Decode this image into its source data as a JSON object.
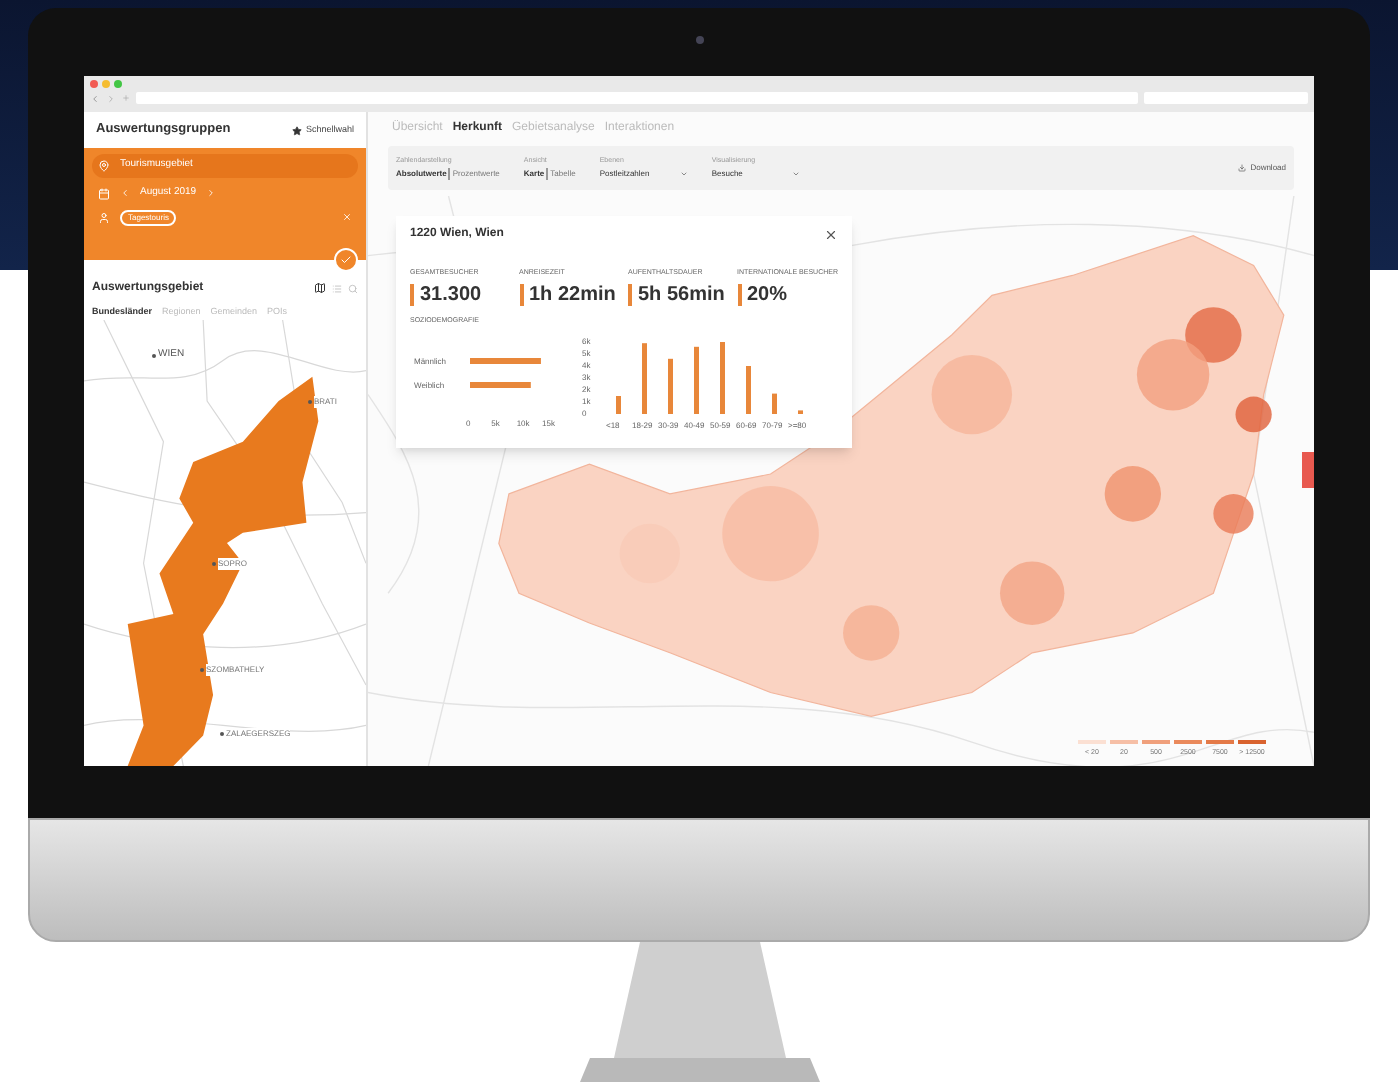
{
  "sidebar": {
    "title": "Auswertungsgruppen",
    "quick_pick": "Schnellwahl",
    "group": {
      "area": "Tourismusgebiet",
      "month": "August 2019",
      "tag": "Tagestouris"
    },
    "area_title": "Auswertungsgebiet",
    "area_tabs": [
      {
        "label": "Bundesländer",
        "selected": true
      },
      {
        "label": "Regionen",
        "selected": false
      },
      {
        "label": "Gemeinden",
        "selected": false
      },
      {
        "label": "POIs",
        "selected": false
      }
    ],
    "map_labels": [
      "WIEN",
      "BRATI",
      "SOPRO",
      "SZOMBATHELY",
      "ZALAEGERSZEG"
    ]
  },
  "tabs": [
    {
      "label": "Übersicht",
      "selected": false
    },
    {
      "label": "Herkunft",
      "selected": true
    },
    {
      "label": "Gebietsanalyse",
      "selected": false
    },
    {
      "label": "Interaktionen",
      "selected": false
    }
  ],
  "filters": [
    {
      "kind": "toggle",
      "label": "Zahlendarstellung",
      "options": [
        {
          "label": "Absolutwerte",
          "selected": true
        },
        {
          "label": "Prozentwerte",
          "selected": false
        }
      ]
    },
    {
      "kind": "toggle",
      "label": "Ansicht",
      "options": [
        {
          "label": "Karte",
          "selected": true
        },
        {
          "label": "Tabelle",
          "selected": false
        }
      ]
    },
    {
      "kind": "select",
      "label": "Ebenen",
      "value": "Postleitzahlen"
    },
    {
      "kind": "select",
      "label": "Visualisierung",
      "value": "Besuche"
    }
  ],
  "download": "Download",
  "popup": {
    "title": "1220 Wien, Wien",
    "stats": [
      {
        "label": "GESAMTBESUCHER",
        "value": "31.300"
      },
      {
        "label": "ANREISEZEIT",
        "value": "1h 22min"
      },
      {
        "label": "AUFENTHALTSDAUER",
        "value": "5h 56min"
      },
      {
        "label": "INTERNATIONALE BESUCHER",
        "value": "20%"
      }
    ],
    "section": "SOZIODEMOGRAFIE",
    "gender_chart": {
      "chart_data": {
        "type": "bar",
        "orientation": "horizontal",
        "categories": [
          "Männlich",
          "Weiblich"
        ],
        "series": [
          {
            "color": "#e8873a",
            "values": [
              14000,
              12000
            ]
          }
        ],
        "xlim": [
          0,
          15000
        ],
        "xticks": [
          {
            "value": 0,
            "label": "0"
          },
          {
            "value": 5000,
            "label": "5k"
          },
          {
            "value": 10000,
            "label": "10k"
          },
          {
            "value": 15000,
            "label": "15k"
          }
        ]
      }
    },
    "age_chart": {
      "chart_data": {
        "type": "bar",
        "categories": [
          "<18",
          "18-29",
          "30-39",
          "40-49",
          "50-59",
          "60-69",
          "70-79",
          ">=80"
        ],
        "series": [
          {
            "color": "#e8873a",
            "values": [
              1500,
              5900,
              4600,
              5600,
              6000,
              4000,
              1700,
              300
            ]
          }
        ],
        "ylim": [
          0,
          6000
        ],
        "yticks": [
          {
            "value": 0,
            "label": "0"
          },
          {
            "value": 1000,
            "label": "1k"
          },
          {
            "value": 2000,
            "label": "2k"
          },
          {
            "value": 3000,
            "label": "3k"
          },
          {
            "value": 4000,
            "label": "4k"
          },
          {
            "value": 5000,
            "label": "5k"
          },
          {
            "value": 6000,
            "label": "6k"
          }
        ]
      }
    }
  },
  "legend": {
    "labels": [
      "< 20",
      "20",
      "500",
      "2500",
      "7500",
      "> 12500"
    ]
  }
}
